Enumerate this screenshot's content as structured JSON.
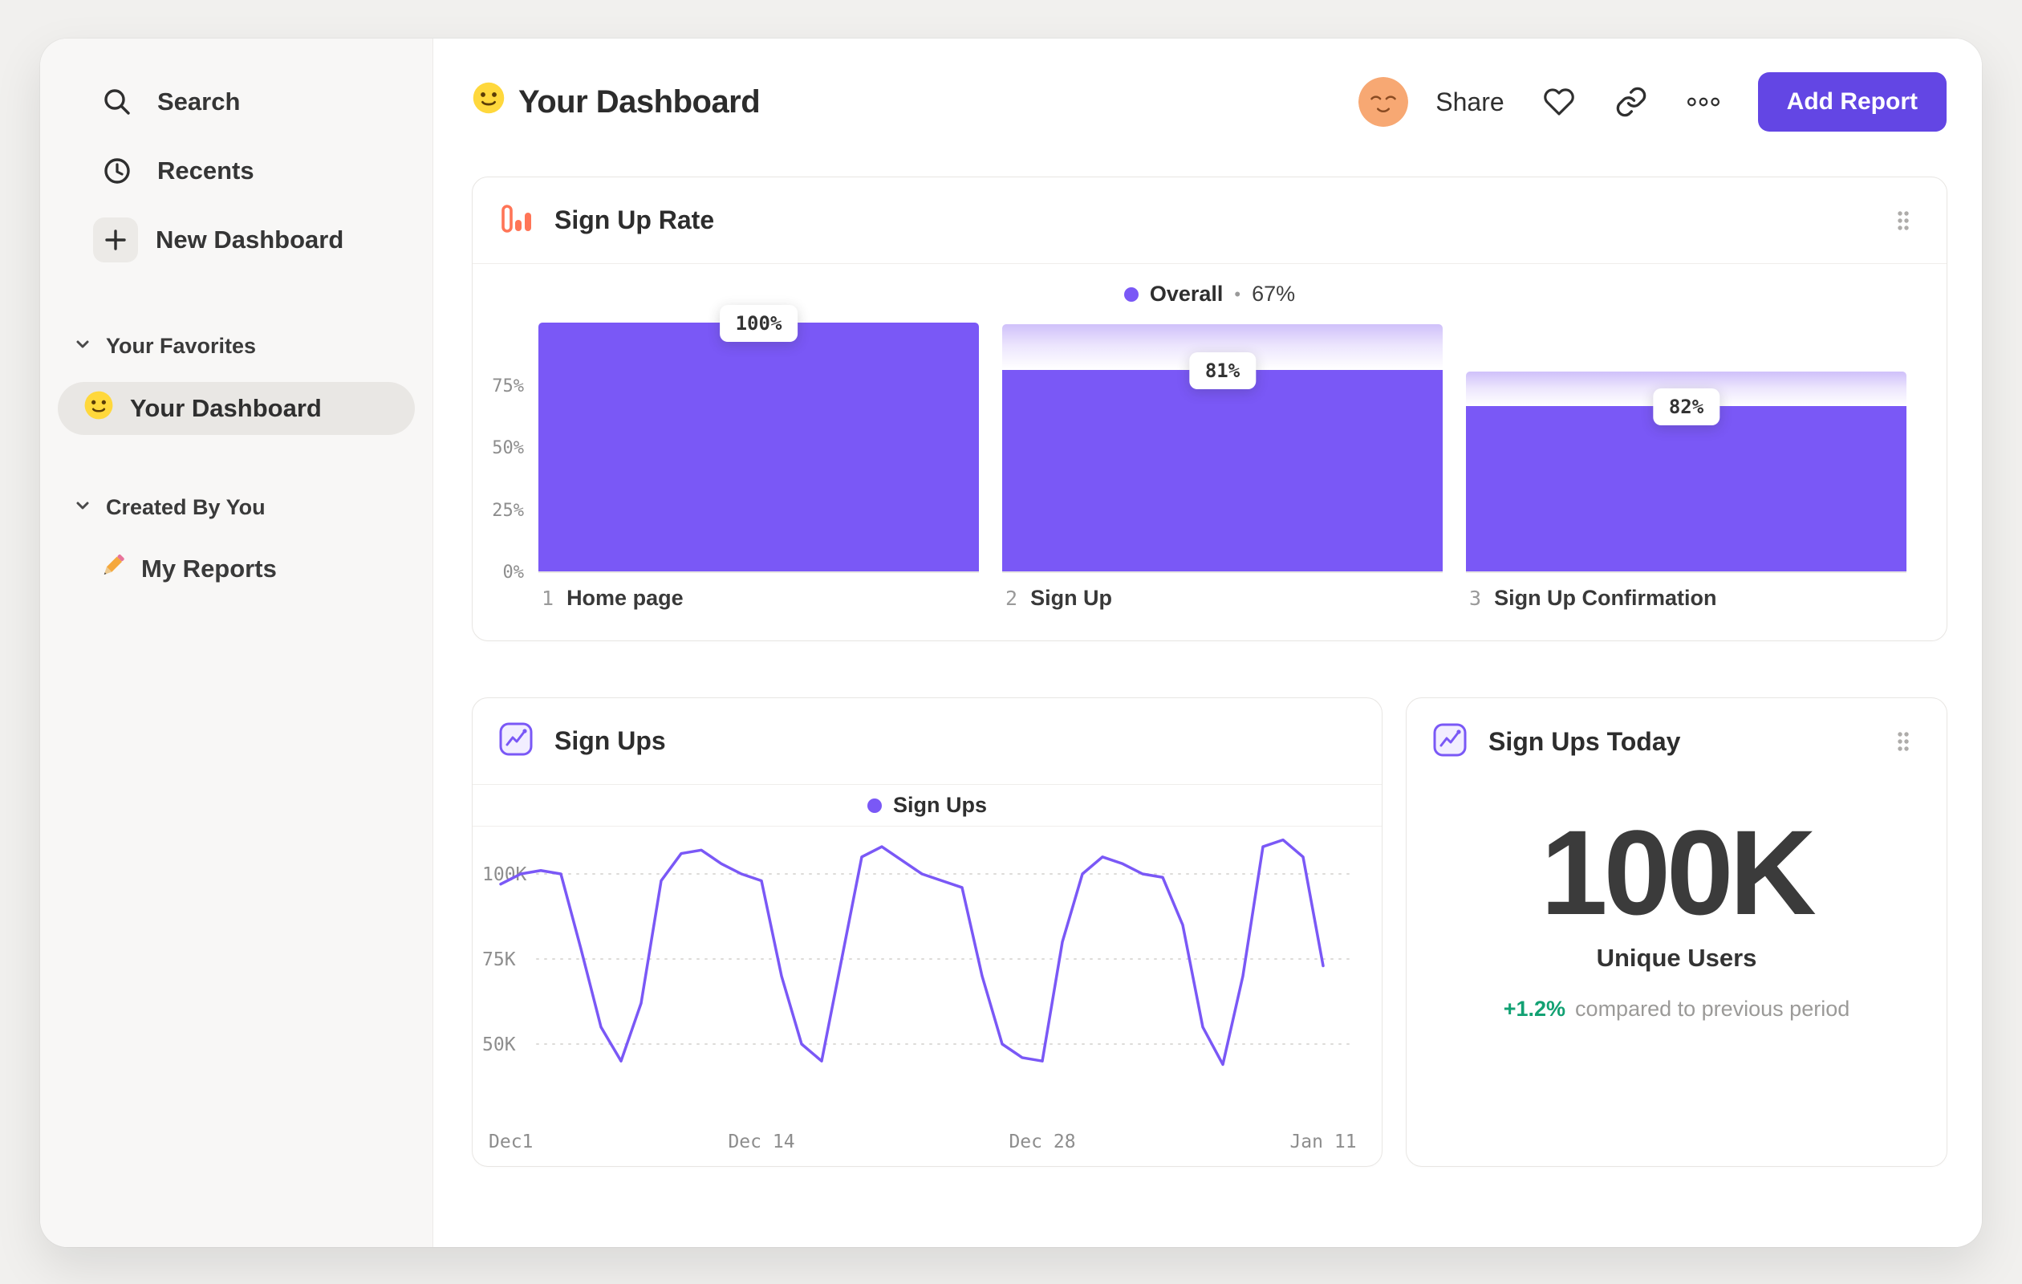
{
  "sidebar": {
    "search": "Search",
    "recents": "Recents",
    "new_dashboard": "New Dashboard",
    "favorites_header": "Your Favorites",
    "favorite_item": "Your Dashboard",
    "created_header": "Created By You",
    "created_item": "My Reports"
  },
  "header": {
    "title": "Your Dashboard",
    "share": "Share",
    "add_report": "Add Report"
  },
  "colors": {
    "purple": "#7a58f6",
    "button_purple": "#6346e4",
    "orange": "#ff7557",
    "green": "#12a173",
    "grid_gray": "#dddbd9",
    "tick_gray": "#8d8d8d"
  },
  "funnel_card": {
    "title": "Sign Up Rate",
    "legend_label": "Overall",
    "legend_sep": "•",
    "legend_value": "67%"
  },
  "line_card": {
    "title": "Sign Ups",
    "legend_label": "Sign Ups"
  },
  "kpi_card": {
    "title": "Sign Ups Today",
    "value": "100K",
    "subtitle": "Unique Users",
    "delta": "+1.2%",
    "delta_note": "compared to previous period"
  },
  "chart_data": [
    {
      "type": "bar",
      "title": "Sign Up Rate",
      "overall_conversion": "67%",
      "categories": [
        "Home page",
        "Sign Up",
        "Sign Up Confirmation"
      ],
      "steps": [
        {
          "number": "1",
          "name": "Home page",
          "label": "100%",
          "height_pct": 100,
          "prev_pct": 100
        },
        {
          "number": "2",
          "name": "Sign Up",
          "label": "81%",
          "height_pct": 81,
          "prev_pct": 100
        },
        {
          "number": "3",
          "name": "Sign Up Confirmation",
          "label": "82%",
          "height_pct": 66.4,
          "prev_pct": 81
        }
      ],
      "y_ticks": [
        {
          "label": "75%",
          "pct": 75
        },
        {
          "label": "50%",
          "pct": 50
        },
        {
          "label": "25%",
          "pct": 25
        },
        {
          "label": "0%",
          "pct": 0
        }
      ],
      "ylim": [
        0,
        100
      ]
    },
    {
      "type": "line",
      "title": "Sign Ups",
      "unit": "K users",
      "x_ticks": [
        {
          "label": "Dec1",
          "day": 0
        },
        {
          "label": "Dec 14",
          "day": 13
        },
        {
          "label": "Dec 28",
          "day": 27
        },
        {
          "label": "Jan 11",
          "day": 41
        }
      ],
      "y_ticks": [
        {
          "label": "100K",
          "value": 100
        },
        {
          "label": "75K",
          "value": 75
        },
        {
          "label": "50K",
          "value": 50
        }
      ],
      "ylim": [
        40,
        112
      ],
      "values_k": [
        97,
        100,
        101,
        100,
        78,
        55,
        45,
        62,
        98,
        106,
        107,
        103,
        100,
        98,
        70,
        50,
        45,
        75,
        105,
        108,
        104,
        100,
        98,
        96,
        70,
        50,
        46,
        45,
        80,
        100,
        105,
        103,
        100,
        99,
        85,
        55,
        44,
        70,
        108,
        110,
        105,
        73
      ]
    }
  ]
}
